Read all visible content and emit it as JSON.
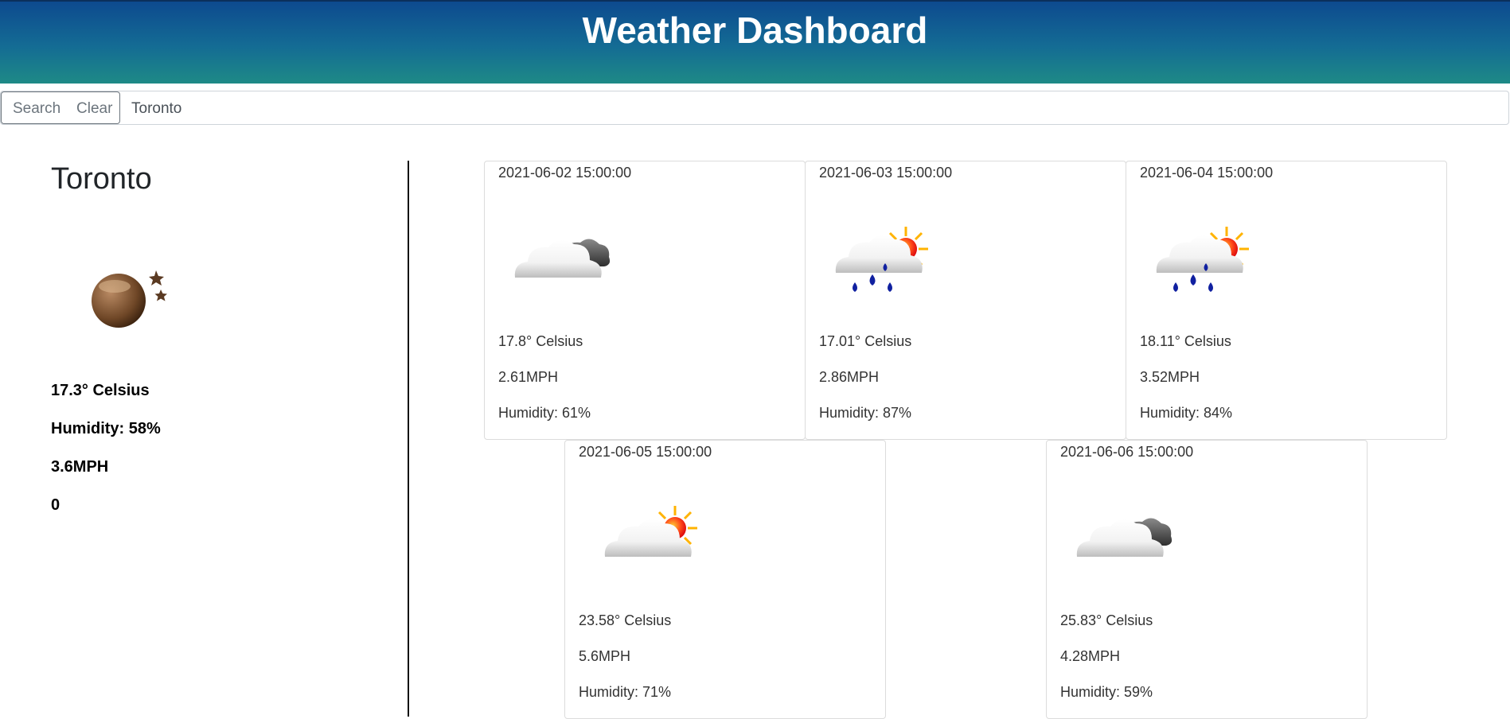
{
  "header": {
    "title": "Weather Dashboard"
  },
  "search": {
    "search_label": "Search",
    "clear_label": "Clear",
    "value": "Toronto"
  },
  "current": {
    "city": "Toronto",
    "icon": "moon-night-icon",
    "temp": "17.3° Celsius",
    "humidity": "Humidity: 58%",
    "wind": "3.6MPH",
    "uv": "0"
  },
  "forecast": [
    {
      "date": "2021-06-02 15:00:00",
      "icon": "cloudy-icon",
      "temp": "17.8° Celsius",
      "wind": "2.61MPH",
      "humidity": "Humidity: 61%"
    },
    {
      "date": "2021-06-03 15:00:00",
      "icon": "rain-sun-icon",
      "temp": "17.01° Celsius",
      "wind": "2.86MPH",
      "humidity": "Humidity: 87%"
    },
    {
      "date": "2021-06-04 15:00:00",
      "icon": "rain-sun-icon",
      "temp": "18.11° Celsius",
      "wind": "3.52MPH",
      "humidity": "Humidity: 84%"
    },
    {
      "date": "2021-06-05 15:00:00",
      "icon": "partly-sunny-icon",
      "temp": "23.58° Celsius",
      "wind": "5.6MPH",
      "humidity": "Humidity: 71%"
    },
    {
      "date": "2021-06-06 15:00:00",
      "icon": "cloudy-icon",
      "temp": "25.83° Celsius",
      "wind": "4.28MPH",
      "humidity": "Humidity: 59%"
    }
  ]
}
